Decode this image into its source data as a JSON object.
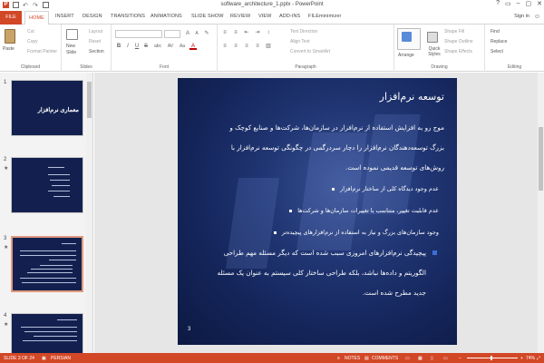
{
  "window": {
    "title": "software_architecture_1.pptx - PowerPoint",
    "controls": [
      "?",
      "▭",
      "–",
      "▢",
      "✕"
    ]
  },
  "tabs": {
    "file": "FILE",
    "items": [
      "HOME",
      "INSERT",
      "DESIGN",
      "TRANSITIONS",
      "ANIMATIONS",
      "SLIDE SHOW",
      "REVIEW",
      "VIEW",
      "ADD-INS",
      "FILEminimizer"
    ],
    "active": "HOME",
    "signin": "Sign in"
  },
  "ribbon": {
    "clipboard": {
      "paste": "Paste",
      "cut": "Cut",
      "copy": "Copy",
      "format_painter": "Format Painter",
      "name": "Clipboard"
    },
    "slides": {
      "new_slide": "New",
      "new_slide2": "Slide",
      "layout": "Layout",
      "reset": "Reset",
      "section": "Section",
      "name": "Slides"
    },
    "font": {
      "name": "Font",
      "bold": "B",
      "italic": "I",
      "underline": "U",
      "strike": "S",
      "shadow": "abc",
      "spacing": "AV",
      "case": "Aa",
      "color": "A"
    },
    "paragraph": {
      "text_direction": "Text Direction",
      "align_text": "Align Text",
      "convert_smartart": "Convert to SmartArt",
      "name": "Paragraph"
    },
    "drawing": {
      "arrange": "Arrange",
      "quick_styles": "Quick Styles",
      "shape_fill": "Shape Fill",
      "shape_outline": "Shape Outline",
      "shape_effects": "Shape Effects",
      "name": "Drawing"
    },
    "editing": {
      "find": "Find",
      "replace": "Replace",
      "select": "Select",
      "name": "Editing"
    }
  },
  "thumbnails": [
    {
      "num": "1",
      "title": "معماری نرم‌افزار"
    },
    {
      "num": "2",
      "title": ""
    },
    {
      "num": "3",
      "title": ""
    },
    {
      "num": "4",
      "title": ""
    }
  ],
  "slide": {
    "title": "توسعه نرم‌افزار",
    "para1": [
      "موج رو به افزایش استفاده از نرم‌افزار در سازمان‌ها، شرکت‌ها و صنایع کوچک و",
      "بزرگ توسعه‌دهندگان نرم‌افزار را دچار سردرگمی در چگونگی توسعه نرم‌افزار با",
      "روش‌های توسعه قدیمی نموده است."
    ],
    "bullets": [
      "عدم وجود دیدگاه کلی از ساختار نرم‌افزار",
      "عدم قابلیت تغییر، متناسب با تغییرات سازمان‌ها و شرکت‌ها",
      "وجود سازمان‌های بزرگ و نیاز به استفاده از نرم‌افزارهای پیچیده‌تر"
    ],
    "para2": [
      "پیچیدگی نرم‌افزارهای امروزی سبب شده است که دیگر مسئله مهم طراحی",
      "الگوریتم و داده‌ها نباشد، بلکه طراحی ساختار کلی سیستم به عنوان یک مسئله",
      "جدید مطرح شده است."
    ],
    "page_number": "3"
  },
  "status": {
    "slide_of": "SLIDE 3 OF 24",
    "language": "PERSIAN",
    "notes": "NOTES",
    "comments": "COMMENTS",
    "zoom": "74%"
  },
  "colors": {
    "accent": "#d24726",
    "slide_bg": "#14255a"
  }
}
